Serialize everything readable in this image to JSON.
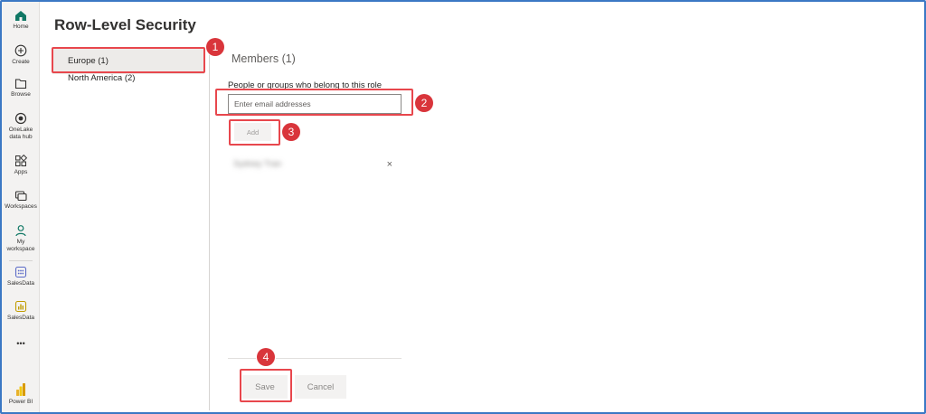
{
  "nav": {
    "home": "Home",
    "create": "Create",
    "browse": "Browse",
    "onelake": "OneLake data hub",
    "apps": "Apps",
    "workspaces": "Workspaces",
    "my_workspace": "My workspace",
    "salesdata_1": "SalesData",
    "salesdata_2": "SalesData",
    "more": "•••",
    "powerbi": "Power BI"
  },
  "page": {
    "title": "Row-Level Security"
  },
  "roles": [
    {
      "label": "Europe (1)",
      "selected": true
    },
    {
      "label": "North America (2)",
      "selected": false
    }
  ],
  "members": {
    "title": "Members (1)",
    "help_text": "People or groups who belong to this role",
    "email_placeholder": "Enter email addresses",
    "add_label": "Add",
    "list": [
      {
        "name": "Sydney Tran",
        "remove_symbol": "×"
      }
    ]
  },
  "footer": {
    "save_label": "Save",
    "cancel_label": "Cancel"
  },
  "annotations": {
    "step1": "1",
    "step2": "2",
    "step3": "3",
    "step4": "4"
  },
  "colors": {
    "accent": "#117865",
    "callout": "#e8474d",
    "badge": "#d9353b",
    "frame": "#3b78c4"
  }
}
